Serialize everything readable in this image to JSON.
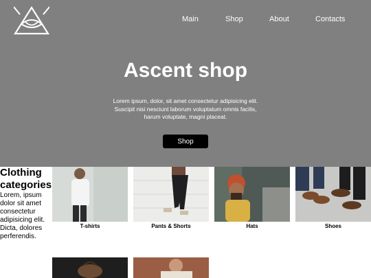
{
  "nav": {
    "items": [
      "Main",
      "Shop",
      "About",
      "Contacts"
    ]
  },
  "hero": {
    "title": "Ascent shop",
    "description": "Lorem ipsum, dolor, sit amet consectetur adipisicing elit. Suscipit nisi nesciunt laborum voluptatum omnis facilis, harum voluptate, magni placeat.",
    "button_label": "Shop"
  },
  "categories": {
    "heading": "Clothing categories",
    "text": "Lorem, ipsum dolor sit amet consectetur adipisicing elit. Dicta, dolores perferendis.",
    "items": [
      {
        "label": "T-shirts"
      },
      {
        "label": "Pants & Shorts"
      },
      {
        "label": "Hats"
      },
      {
        "label": "Shoes"
      },
      {
        "label": ""
      },
      {
        "label": ""
      }
    ]
  },
  "colors": {
    "hero_bg": "#808080",
    "button_bg": "#000000",
    "text_light": "#ffffff"
  }
}
